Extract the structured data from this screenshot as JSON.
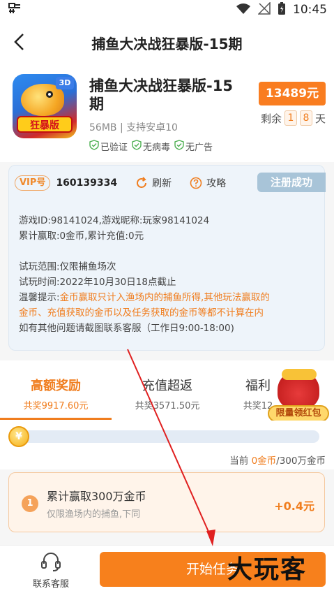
{
  "status_bar": {
    "left_icon": "sim-icon",
    "time": "10:45"
  },
  "header": {
    "title": "捕鱼大决战狂暴版-15期"
  },
  "product": {
    "name": "捕鱼大决战狂暴版-15期",
    "icon_badge": "3D",
    "icon_banner": "狂暴版",
    "meta": "56MB | 支持安卓10",
    "verifications": [
      "已验证",
      "无病毒",
      "无广告"
    ],
    "price": "13489元",
    "remain_prefix": "剩余",
    "remain_digits": [
      "1",
      "8"
    ],
    "remain_suffix": "天"
  },
  "account": {
    "vip_label": "VIP号",
    "vip_id": "160139334",
    "refresh_label": "刷新",
    "guide_label": "攻略",
    "register_status": "注册成功",
    "line1": "游戏ID:98141024,游戏昵称:玩家98141024",
    "line2": "累计赢取:0金币,累计充值:0元",
    "line3": "试玩范围:仅限捕鱼场次",
    "line4": "试玩时间:2022年10月30日18点截止",
    "tip_prefix": "温馨提示:",
    "tip_body_1": "金币赢取只计入渔场内的捕鱼所得,其他玩法赢取的",
    "tip_body_2": "金币、充值获取的金币以及任务获取的金币等都不计算在内",
    "line6": "如有其他问题请截图联系客服（工作日9:00-18:00)"
  },
  "tabs": [
    {
      "label": "高额奖励",
      "sub": "共奖9917.60元",
      "active": true
    },
    {
      "label": "充值超返",
      "sub": "共奖3571.50元",
      "active": false
    },
    {
      "label": "福利",
      "sub": "共奖12",
      "active": false
    }
  ],
  "redpacket": {
    "label": "限量领红包"
  },
  "progress": {
    "coin_symbol": "¥",
    "fill_fraction": 0.0,
    "text_prefix": "当前 ",
    "current": "0金币",
    "text_suffix": "/300万金币"
  },
  "task": {
    "number": "1",
    "title": "累计赢取300万金币",
    "subtitle": "仅限渔场内的捕鱼,下同",
    "reward": "+0.4元"
  },
  "bottom": {
    "service_label": "联系客服",
    "start_label": "开始任务"
  },
  "watermark": "大玩客",
  "colors": {
    "accent": "#f07d1e",
    "price_bg": "#f97d20",
    "start_btn": "#f7801c",
    "register_bg": "#a8c4d8",
    "arrow": "#e02020"
  }
}
